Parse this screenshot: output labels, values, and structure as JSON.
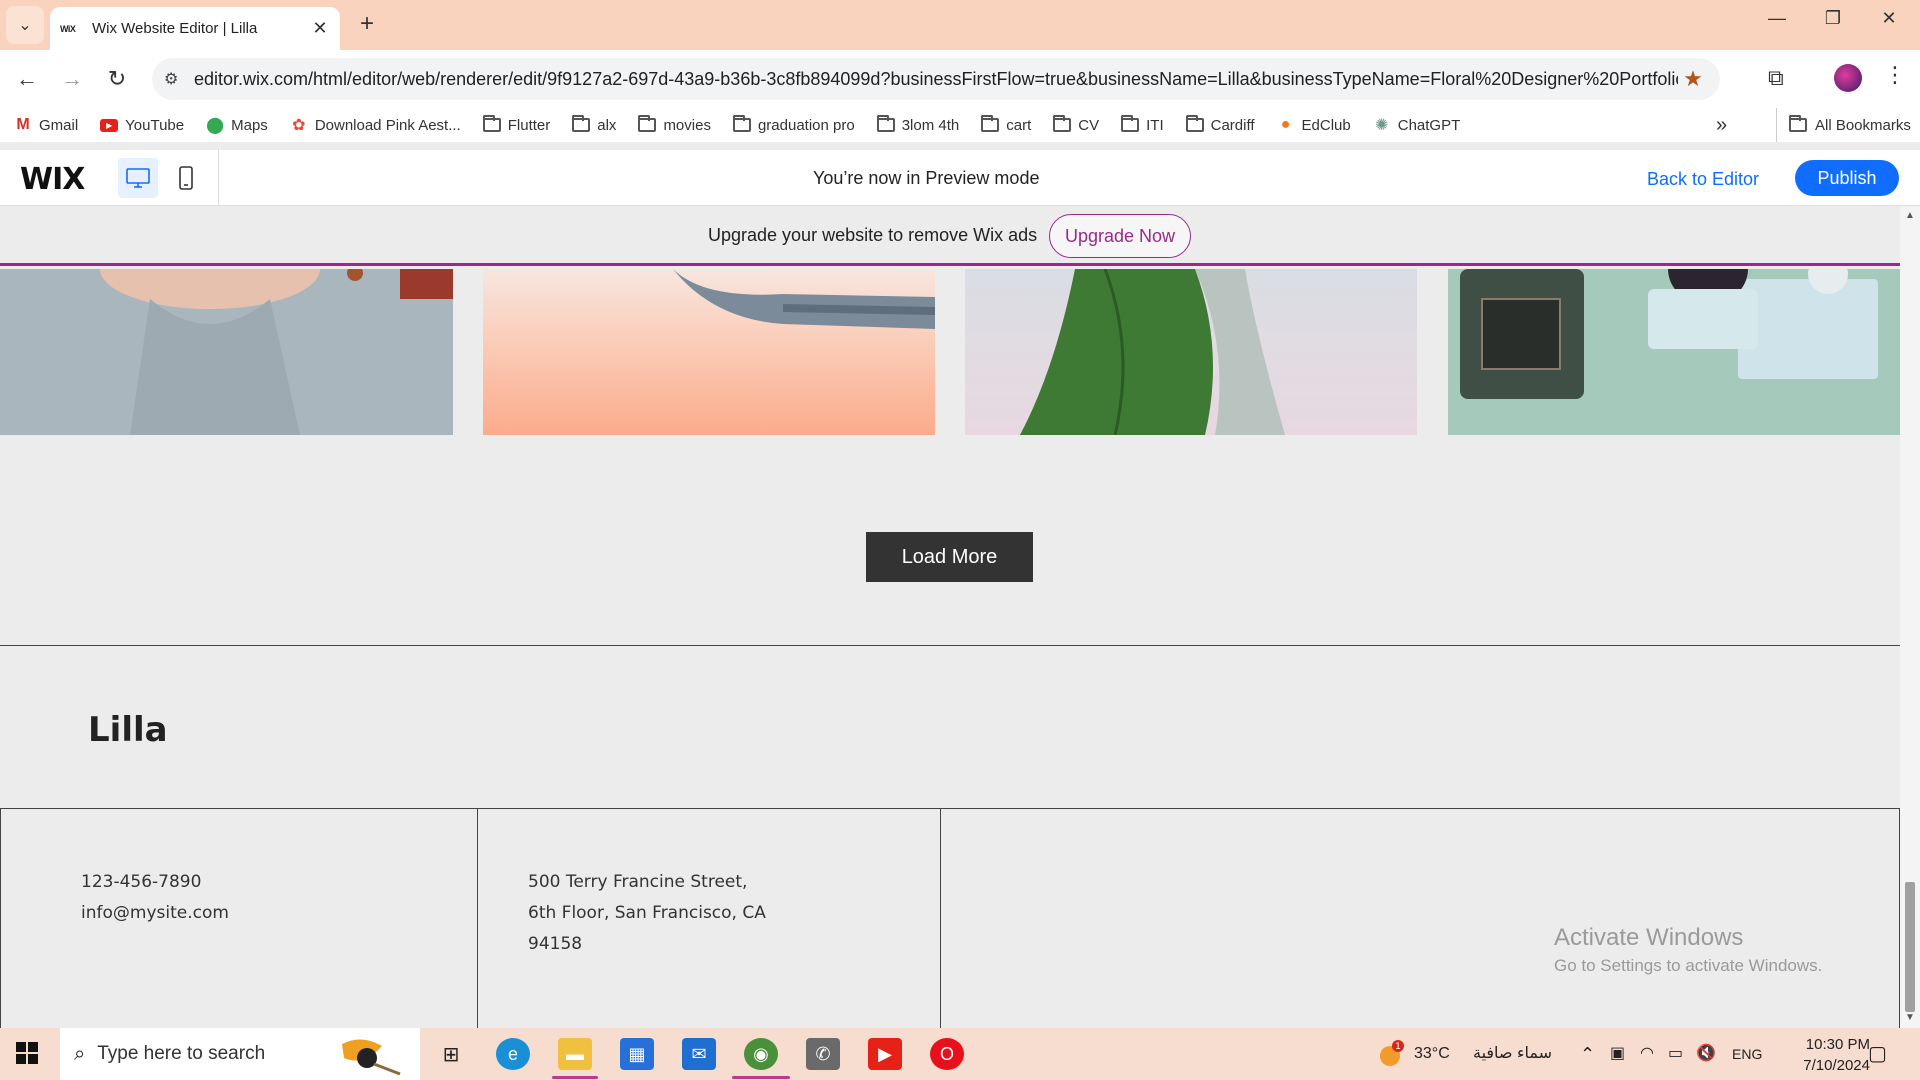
{
  "browser": {
    "tab_title": "Wix Website Editor | Lilla",
    "tab_favicon": "WiX",
    "url": "editor.wix.com/html/editor/web/renderer/edit/9f9127a2-697d-43a9-b36b-3c8fb894099d?businessFirstFlow=true&businessName=Lilla&businessTypeName=Floral%20Designer%20Portfolio&in...",
    "bookmarks": [
      {
        "label": "Gmail",
        "icon": "gmail-icon"
      },
      {
        "label": "YouTube",
        "icon": "youtube-icon"
      },
      {
        "label": "Maps",
        "icon": "maps-icon"
      },
      {
        "label": "Download Pink Aest...",
        "icon": "pinwheel-icon"
      },
      {
        "label": "Flutter",
        "icon": "folder-icon"
      },
      {
        "label": "alx",
        "icon": "folder-icon"
      },
      {
        "label": "movies",
        "icon": "folder-icon"
      },
      {
        "label": "graduation pro",
        "icon": "folder-icon"
      },
      {
        "label": "3lom 4th",
        "icon": "folder-icon"
      },
      {
        "label": "cart",
        "icon": "folder-icon"
      },
      {
        "label": "CV",
        "icon": "folder-icon"
      },
      {
        "label": "ITI",
        "icon": "folder-icon"
      },
      {
        "label": "Cardiff",
        "icon": "folder-icon"
      },
      {
        "label": "EdClub",
        "icon": "edclub-icon"
      },
      {
        "label": "ChatGPT",
        "icon": "chatgpt-icon"
      }
    ],
    "all_bookmarks": "All Bookmarks"
  },
  "wix_bar": {
    "logo": "WIX",
    "preview_message": "You’re now in Preview mode",
    "back_to_editor": "Back to Editor",
    "publish": "Publish"
  },
  "upgrade_banner": {
    "text": "Upgrade your website to remove Wix ads",
    "button": "Upgrade Now"
  },
  "site": {
    "load_more": "Load More",
    "name": "Lilla",
    "phone": "123-456-7890",
    "email": "info@mysite.com",
    "address_line1": "500 Terry Francine Street,",
    "address_line2": "6th Floor, San Francisco, CA",
    "address_line3": "94158"
  },
  "watermark": {
    "title": "Activate Windows",
    "subtitle": "Go to Settings to activate Windows."
  },
  "taskbar": {
    "search_placeholder": "Type here to search",
    "weather_temp": "33°C",
    "weather_desc": "سماء صافية",
    "weather_badge": "1",
    "language": "ENG",
    "time": "10:30 PM",
    "date": "7/10/2024"
  },
  "colors": {
    "accent": "#116dff",
    "upgrade": "#9a2a8a",
    "titlebar": "#f9d3bd"
  }
}
